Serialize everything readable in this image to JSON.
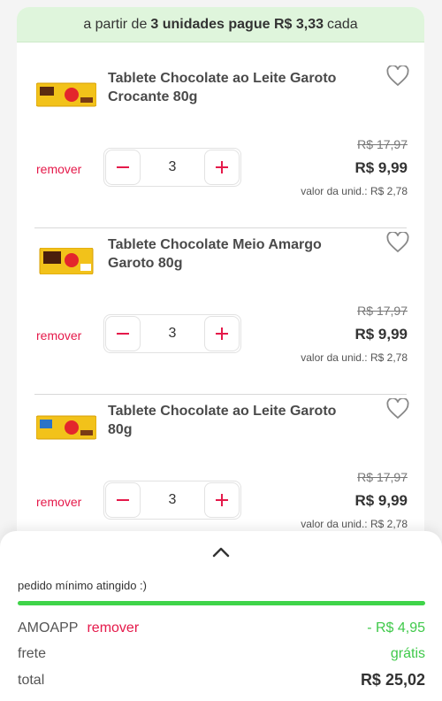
{
  "promo": {
    "prefix": "a partir de",
    "highlight": "3 unidades pague R$ 3,33",
    "suffix": "cada"
  },
  "items": [
    {
      "name": "Tablete Chocolate ao Leite Garoto Crocante 80g",
      "remove_label": "remover",
      "quantity": "3",
      "old_price": "R$ 17,97",
      "price": "R$ 9,99",
      "unit_price": "valor da unid.: R$ 2,78"
    },
    {
      "name": "Tablete Chocolate Meio Amargo Garoto 80g",
      "remove_label": "remover",
      "quantity": "3",
      "old_price": "R$ 17,97",
      "price": "R$ 9,99",
      "unit_price": "valor da unid.: R$ 2,78"
    },
    {
      "name": "Tablete Chocolate ao Leite Garoto 80g",
      "remove_label": "remover",
      "quantity": "3",
      "old_price": "R$ 17,97",
      "price": "R$ 9,99",
      "unit_price": "valor da unid.: R$ 2,78"
    }
  ],
  "summary": {
    "minimum_text": "pedido mínimo atingido :)",
    "minimum_progress": 1.0,
    "coupon_code": "AMOAPP",
    "coupon_remove": "remover",
    "coupon_discount": "- R$ 4,95",
    "shipping_label": "frete",
    "shipping_value": "grátis",
    "total_label": "total",
    "total_value": "R$ 25,02"
  },
  "colors": {
    "accent_red": "#e5194a",
    "accent_green": "#3fd449",
    "promo_bg": "#dff5dc"
  },
  "icons": {
    "favorite": "heart-outline-icon",
    "decrease": "minus-icon",
    "increase": "plus-icon",
    "expand": "chevron-up-icon"
  }
}
